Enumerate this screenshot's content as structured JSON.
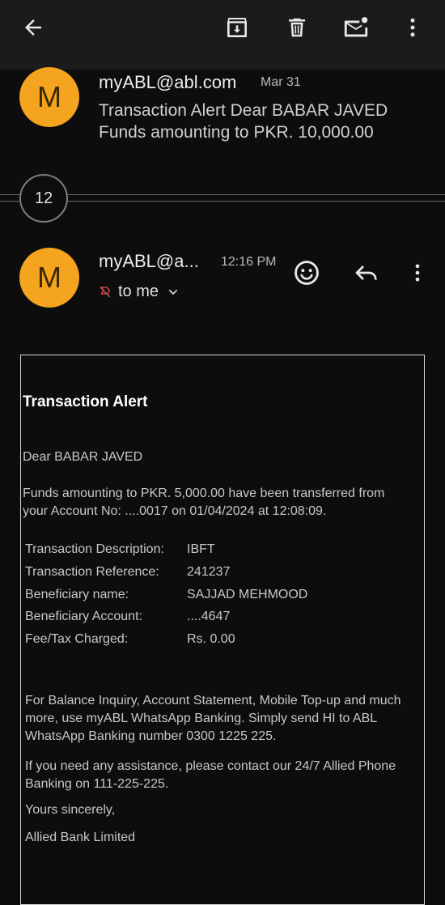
{
  "toolbar": {
    "icons": [
      "back-arrow-icon",
      "archive-icon",
      "trash-icon",
      "mark-unread-icon",
      "more-vert-icon"
    ]
  },
  "collapsed_message": {
    "avatar_letter": "M",
    "sender": "myABL@abl.com",
    "date": "Mar 31",
    "snippet": "Transaction Alert Dear BABAR JAVED Funds amounting to PKR. 10,000.00"
  },
  "thread": {
    "collapsed_count": "12"
  },
  "open_message": {
    "avatar_letter": "M",
    "sender": "myABL@a...",
    "time": "12:16 PM",
    "recipient": "to me"
  },
  "email_body": {
    "title": "Transaction Alert",
    "greeting": "Dear BABAR JAVED",
    "intro": "Funds amounting to PKR. 5,000.00 have been transferred from your Account No: ....0017 on 01/04/2024 at 12:08:09.",
    "details": [
      {
        "label": "Transaction Description:",
        "value": "IBFT"
      },
      {
        "label": "Transaction Reference:",
        "value": "241237"
      },
      {
        "label": "Beneficiary name:",
        "value": "SAJJAD MEHMOOD"
      },
      {
        "label": "Beneficiary Account:",
        "value": "....4647"
      },
      {
        "label": "Fee/Tax Charged:",
        "value": "Rs. 0.00"
      }
    ],
    "whatsapp_note": "For Balance Inquiry, Account Statement, Mobile Top-up and much more, use myABL WhatsApp Banking. Simply send HI to ABL WhatsApp Banking number 0300 1225 225.",
    "assistance_note": "If you need any assistance, please contact our 24/7 Allied Phone Banking on 111-225-225.",
    "closing": "Yours sincerely,",
    "signature": "Allied Bank Limited"
  },
  "colors": {
    "avatar": "#f4a41e",
    "background": "#0d0d0d",
    "toolbar": "#1b1b1b"
  }
}
